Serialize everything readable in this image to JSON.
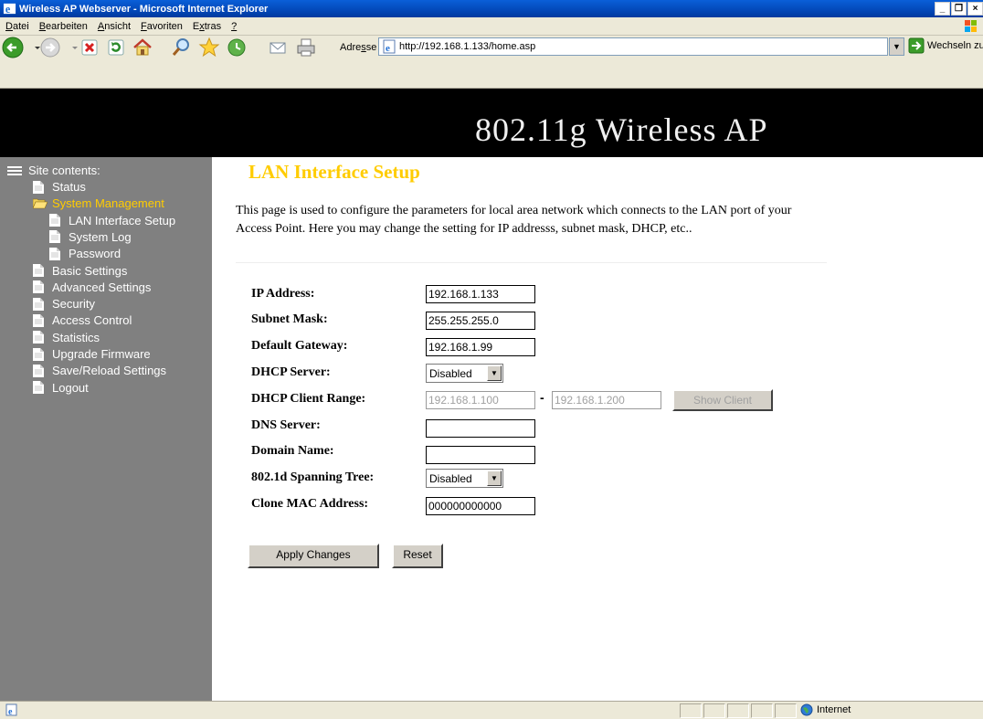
{
  "window": {
    "title": "Wireless AP Webserver - Microsoft Internet Explorer",
    "controls": [
      "_",
      "❐",
      "×"
    ]
  },
  "menu": [
    {
      "pre": "",
      "ul": "D",
      "post": "atei"
    },
    {
      "pre": "",
      "ul": "B",
      "post": "earbeiten"
    },
    {
      "pre": "",
      "ul": "A",
      "post": "nsicht"
    },
    {
      "pre": "",
      "ul": "F",
      "post": "avoriten"
    },
    {
      "pre": "E",
      "ul": "x",
      "post": "tras"
    },
    {
      "pre": "",
      "ul": "?",
      "post": ""
    }
  ],
  "toolbar": {
    "address_label_pre": "Adre",
    "address_label_ul": "s",
    "address_label_post": "se",
    "address_url": "http://192.168.1.133/home.asp",
    "go_label": "Wechseln zu"
  },
  "banner": {
    "title": "802.11g Wireless AP"
  },
  "sidebar": {
    "heading": "Site contents:",
    "items": [
      {
        "label": "Status",
        "level": 1,
        "icon": "doc-icon"
      },
      {
        "label": "System Management",
        "level": 1,
        "icon": "folder-open-icon",
        "active": true
      },
      {
        "label": "LAN Interface Setup",
        "level": 2,
        "icon": "doc-icon"
      },
      {
        "label": "System Log",
        "level": 2,
        "icon": "doc-icon"
      },
      {
        "label": "Password",
        "level": 2,
        "icon": "doc-icon"
      },
      {
        "label": "Basic Settings",
        "level": 1,
        "icon": "doc-icon"
      },
      {
        "label": "Advanced Settings",
        "level": 1,
        "icon": "doc-icon"
      },
      {
        "label": "Security",
        "level": 1,
        "icon": "doc-icon"
      },
      {
        "label": "Access Control",
        "level": 1,
        "icon": "doc-icon"
      },
      {
        "label": "Statistics",
        "level": 1,
        "icon": "doc-icon"
      },
      {
        "label": "Upgrade Firmware",
        "level": 1,
        "icon": "doc-icon"
      },
      {
        "label": "Save/Reload Settings",
        "level": 1,
        "icon": "doc-icon"
      },
      {
        "label": "Logout",
        "level": 1,
        "icon": "doc-icon"
      }
    ]
  },
  "page": {
    "title": "LAN Interface Setup",
    "description": "This page is used to configure the parameters for local area network which connects to the LAN port of your Access Point. Here you may change the setting for IP addresss, subnet mask, DHCP, etc..",
    "form": {
      "ip_label": "IP Address:",
      "ip_value": "192.168.1.133",
      "mask_label": "Subnet Mask:",
      "mask_value": "255.255.255.0",
      "gw_label": "Default Gateway:",
      "gw_value": "192.168.1.99",
      "dhcp_label": "DHCP Server:",
      "dhcp_value": "Disabled",
      "range_label": "DHCP Client Range:",
      "range_start": "192.168.1.100",
      "range_dash": "-",
      "range_end": "192.168.1.200",
      "show_client_label": "Show Client",
      "dns_label": "DNS Server:",
      "dns_value": "",
      "domain_label": "Domain Name:",
      "domain_value": "",
      "stp_label": "802.1d Spanning Tree:",
      "stp_value": "Disabled",
      "mac_label": "Clone MAC Address:",
      "mac_value": "000000000000"
    },
    "apply_label": "Apply Changes",
    "reset_label": "Reset"
  },
  "statusbar": {
    "zone": "Internet"
  }
}
